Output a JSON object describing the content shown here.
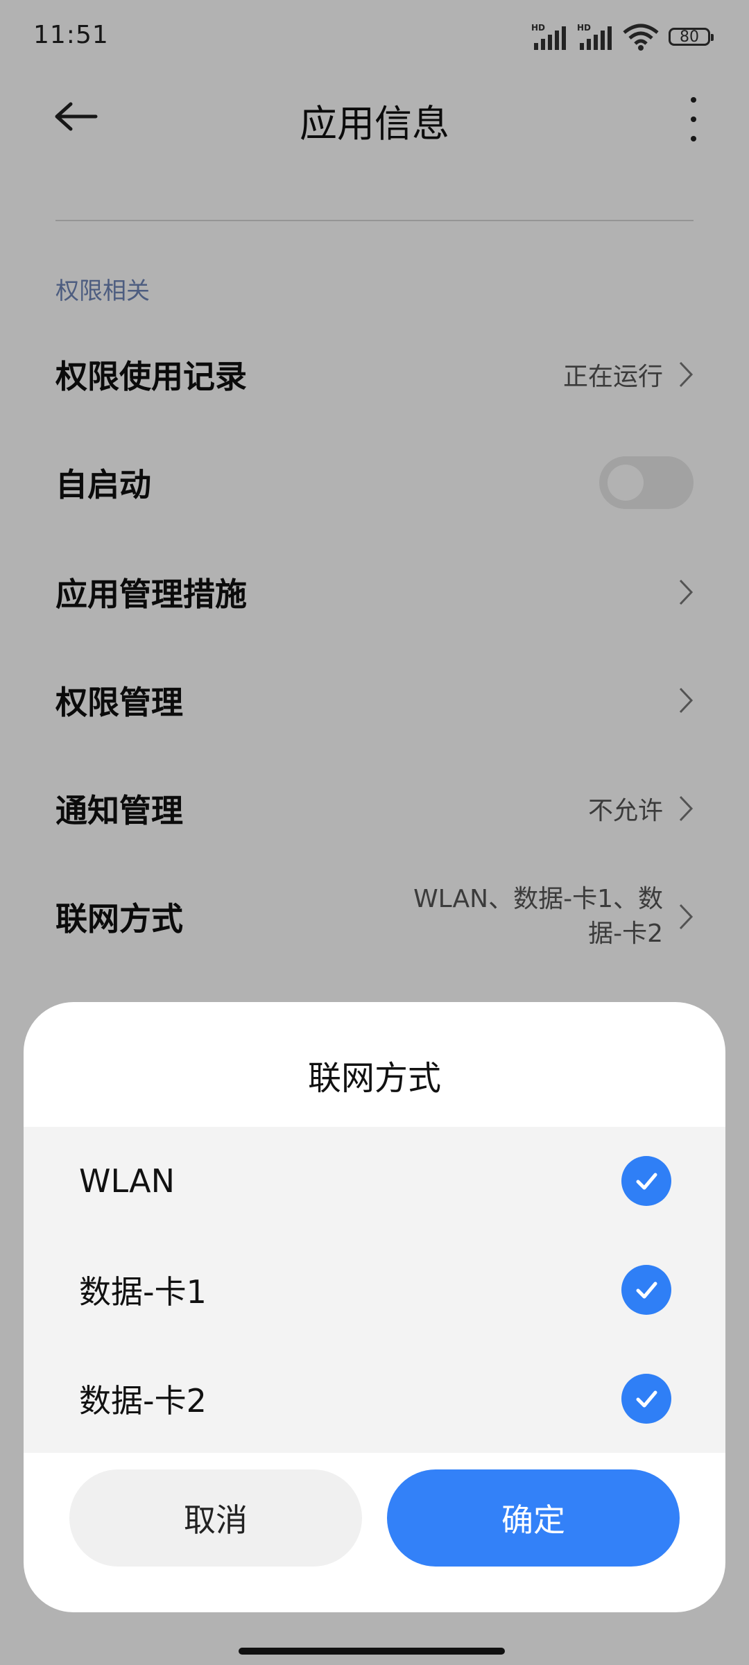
{
  "status_bar": {
    "time": "11:51",
    "battery": "80",
    "icons": [
      "hd-signal-icon",
      "hd-signal-icon",
      "wifi-icon",
      "battery-icon"
    ]
  },
  "header": {
    "title": "应用信息",
    "back_icon": "back-arrow-icon",
    "more_icon": "more-vertical-icon"
  },
  "section": {
    "label": "权限相关"
  },
  "rows": [
    {
      "label": "权限使用记录",
      "value": "正在运行",
      "chevron": true
    },
    {
      "label": "自启动",
      "toggle_on": false
    },
    {
      "label": "应用管理措施",
      "value": "",
      "chevron": true
    },
    {
      "label": "权限管理",
      "value": "",
      "chevron": true
    },
    {
      "label": "通知管理",
      "value": "不允许",
      "chevron": true
    },
    {
      "label": "联网方式",
      "value": "WLAN、数据-卡1、数据-卡2",
      "chevron": true
    }
  ],
  "dialog": {
    "title": "联网方式",
    "options": [
      {
        "label": "WLAN",
        "checked": true
      },
      {
        "label": "数据-卡1",
        "checked": true
      },
      {
        "label": "数据-卡2",
        "checked": true
      }
    ],
    "cancel_label": "取消",
    "confirm_label": "确定",
    "accent_color": "#3381f8"
  }
}
